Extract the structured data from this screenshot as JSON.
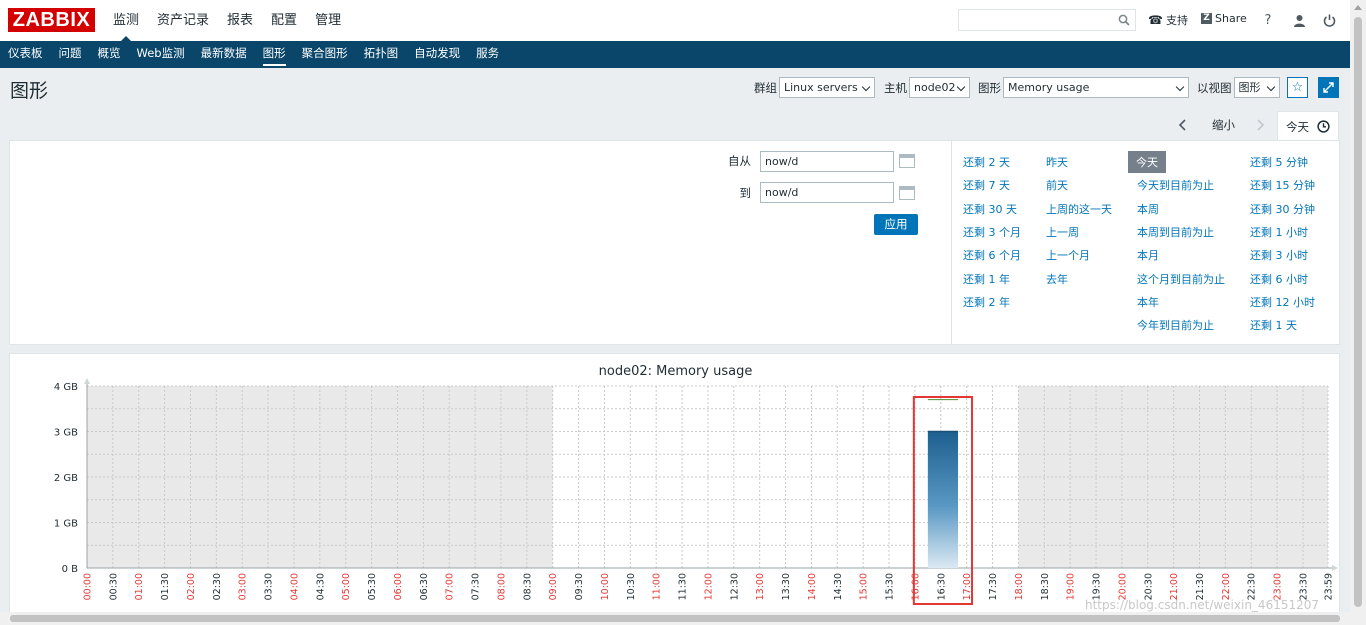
{
  "brand": {
    "logo": "ZABBIX",
    "accent": "#d40000",
    "nav_bg": "#0a466a",
    "link": "#0275b8"
  },
  "topmenu": [
    "监测",
    "资产记录",
    "报表",
    "配置",
    "管理"
  ],
  "topbar": {
    "search_placeholder": "",
    "support": "支持",
    "share": "Share",
    "help": "?"
  },
  "submenu": [
    "仪表板",
    "问题",
    "概览",
    "Web监测",
    "最新数据",
    "图形",
    "聚合图形",
    "拓扑图",
    "自动发现",
    "服务"
  ],
  "page": {
    "title": "图形"
  },
  "filters": {
    "group_label": "群组",
    "group_value": "Linux servers",
    "host_label": "主机",
    "host_value": "node02",
    "graph_label": "图形",
    "graph_value": "Memory usage",
    "view_label": "以视图",
    "view_value": "图形"
  },
  "timenav": {
    "zoom_out": "缩小",
    "today": "今天"
  },
  "timeform": {
    "from_label": "自从",
    "from_value": "now/d",
    "to_label": "到",
    "to_value": "now/d",
    "apply": "应用"
  },
  "quick_ranges": {
    "col1": [
      "还剩 2 天",
      "还剩 7 天",
      "还剩 30 天",
      "还剩 3 个月",
      "还剩 6 个月",
      "还剩 1 年",
      "还剩 2 年"
    ],
    "col2": [
      "昨天",
      "前天",
      "上周的这一天",
      "上一周",
      "上一个月",
      "去年"
    ],
    "col3": [
      "今天",
      "今天到目前为止",
      "本周",
      "本周到目前为止",
      "本月",
      "这个月到目前为止",
      "本年",
      "今年到目前为止"
    ],
    "col4": [
      "还剩 5 分钟",
      "还剩 15 分钟",
      "还剩 30 分钟",
      "还剩 1 小时",
      "还剩 3 小时",
      "还剩 6 小时",
      "还剩 12 小时",
      "还剩 1 天"
    ]
  },
  "chart_data": {
    "type": "area",
    "title": "node02: Memory usage",
    "y_ticks": [
      "0 B",
      "1 GB",
      "2 GB",
      "3 GB",
      "4 GB"
    ],
    "ylim": [
      0,
      4
    ],
    "x_ticks": [
      "00:00",
      "00:30",
      "01:00",
      "01:30",
      "02:00",
      "02:30",
      "03:00",
      "03:30",
      "04:00",
      "04:30",
      "05:00",
      "05:30",
      "06:00",
      "06:30",
      "07:00",
      "07:30",
      "08:00",
      "08:30",
      "09:00",
      "09:30",
      "10:00",
      "10:30",
      "11:00",
      "11:30",
      "12:00",
      "12:30",
      "13:00",
      "13:30",
      "14:00",
      "14:30",
      "15:00",
      "15:30",
      "16:00",
      "16:30",
      "17:00",
      "17:30",
      "18:00",
      "18:30",
      "19:00",
      "19:30",
      "20:00",
      "20:30",
      "21:00",
      "21:30",
      "22:00",
      "22:30",
      "23:00",
      "23:30",
      "23:59"
    ],
    "hour_tick_color": "#e33734",
    "shaded_ranges": [
      [
        "00:00",
        "09:00"
      ],
      [
        "18:00",
        "23:59"
      ]
    ],
    "series": [
      {
        "values_gb_from": "16:15",
        "values_gb_to": "16:50",
        "available": 3.0,
        "total": 3.7
      }
    ],
    "highlight_color": "#e33734"
  },
  "watermark": "https://blog.csdn.net/weixin_46151207"
}
